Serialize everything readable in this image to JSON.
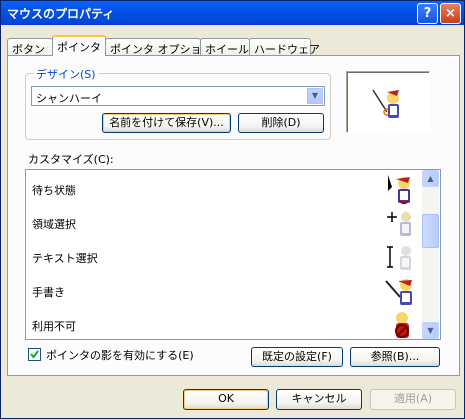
{
  "window": {
    "title": "マウスのプロパティ",
    "help_glyph": "?",
    "close_glyph": "×"
  },
  "tabs": [
    {
      "label": "ボタン"
    },
    {
      "label": "ポインタ"
    },
    {
      "label": "ポインタ オプション"
    },
    {
      "label": "ホイール"
    },
    {
      "label": "ハードウェア"
    }
  ],
  "design": {
    "group_label": "デザイン(S)",
    "scheme_value": "シャンハーイ",
    "save_as_label": "名前を付けて保存(V)...",
    "delete_label": "削除(D)"
  },
  "customize_label": "カスタマイズ(C):",
  "cursors": [
    {
      "label": "待ち状態",
      "icon": "busy-cursor-icon"
    },
    {
      "label": "領域選択",
      "icon": "precision-select-cursor-icon"
    },
    {
      "label": "テキスト選択",
      "icon": "text-select-cursor-icon"
    },
    {
      "label": "手書き",
      "icon": "handwriting-cursor-icon"
    },
    {
      "label": "利用不可",
      "icon": "unavailable-cursor-icon"
    }
  ],
  "shadow_checkbox": {
    "label": "ポインタの影を有効にする(E)",
    "checked": true
  },
  "buttons": {
    "default_label": "既定の設定(F)",
    "browse_label": "参照(B)...",
    "ok_label": "OK",
    "cancel_label": "キャンセル",
    "apply_label": "適用(A)"
  },
  "colors": {
    "title_bar": "#0054e3",
    "accent": "#0046d5",
    "dialog_bg": "#ece9d8"
  }
}
